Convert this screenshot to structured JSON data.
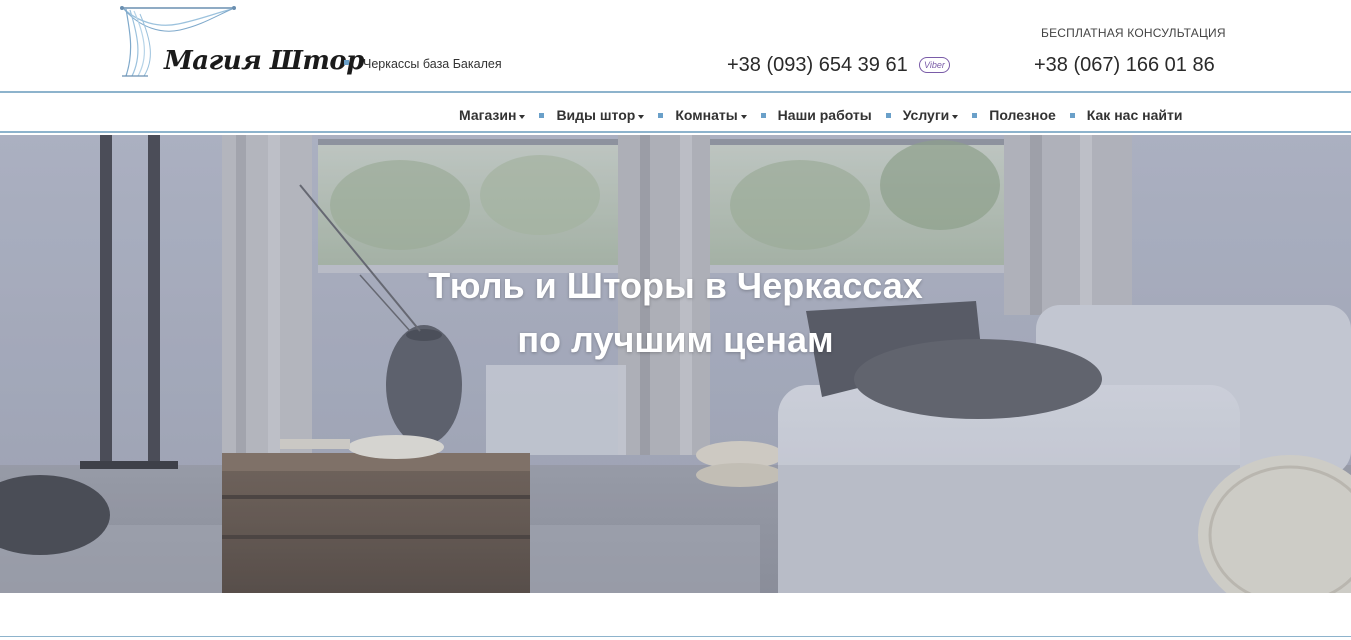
{
  "header": {
    "logo_text": "Магия Штор",
    "location": "Черкассы база Бакалея",
    "phone_primary": "+38 (093) 654 39 61",
    "viber_label": "Viber",
    "consult_label": "БЕСПЛАТНАЯ КОНСУЛЬТАЦИЯ",
    "phone_secondary": "+38 (067) 166 01 86"
  },
  "nav": {
    "items": [
      {
        "label": "Магазин",
        "dropdown": true
      },
      {
        "label": "Виды штор",
        "dropdown": true
      },
      {
        "label": "Комнаты",
        "dropdown": true
      },
      {
        "label": "Наши работы",
        "dropdown": false
      },
      {
        "label": "Услуги",
        "dropdown": true
      },
      {
        "label": "Полезное",
        "dropdown": false
      },
      {
        "label": "Как нас найти",
        "dropdown": false
      }
    ]
  },
  "hero": {
    "title_line1": "Тюль и Шторы в Черкассах",
    "title_line2": "по лучшим ценам"
  },
  "colors": {
    "accent": "#8db3cc",
    "bullet": "#6aa0c9",
    "viber": "#7a5ca8"
  }
}
